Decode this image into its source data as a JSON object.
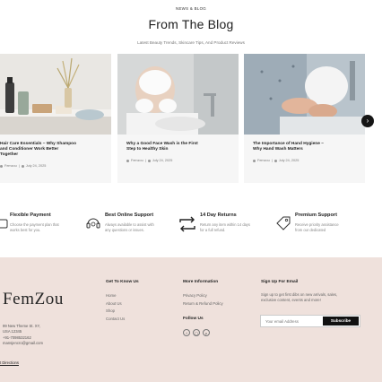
{
  "blog": {
    "eyebrow": "NEWS & BLOG",
    "title": "From The Blog",
    "subtitle": "Latest Beauty Trends, Skincare Tips, And Product Reviews",
    "next_icon": "chevron-right-icon",
    "posts": [
      {
        "title_line1": "Hair Care Essentials – Why Shampoo",
        "title_line2": "and Conditioner Work Better",
        "title_line3": "Together",
        "author": "Femzou",
        "date": "July 24, 2025"
      },
      {
        "title_line1": "Why a Good Face Wash is the First",
        "title_line2": "Step to Healthy Skin",
        "author": "Femzou",
        "date": "July 24, 2025"
      },
      {
        "title_line1": "The Importance of Hand Hygiene –",
        "title_line2": "Why Hand Wash Matters",
        "author": "Femzou",
        "date": "July 24, 2025"
      }
    ]
  },
  "features": [
    {
      "icon": "payment-icon",
      "title": "Flexible Payment",
      "desc_line1": "Choose the payment plan that",
      "desc_line2": "works best for you."
    },
    {
      "icon": "support-headset-icon",
      "title": "Best Online Support",
      "desc_line1": "Always available to assist with",
      "desc_line2": "any questions or issues."
    },
    {
      "icon": "return-arrows-icon",
      "title": "14 Day Returns",
      "desc_line1": "Return any item within 14 days",
      "desc_line2": "for a full refund."
    },
    {
      "icon": "tag-icon",
      "title": "Premium Support",
      "desc_line1": "Receive priority assistance",
      "desc_line2": "from our dedicated"
    }
  ],
  "footer": {
    "brand": "FemZou",
    "address_line1": "99 New Theme St. XY,",
    "address_line2": "USA 12345",
    "phone": "+91-7098532162",
    "email": "mansjencro@gmail.com",
    "directions": "t Directions",
    "col1_head": "Get To Know Us",
    "col1_items": [
      "Home",
      "About Us",
      "Shop",
      "Contact Us"
    ],
    "col2_head": "More Information",
    "col2_items": [
      "Privacy Policy",
      "Return & Refund Policy"
    ],
    "follow_head": "Follow Us",
    "social": [
      "facebook-icon",
      "instagram-icon",
      "pinterest-icon"
    ],
    "signup_head": "Sign Up For Email",
    "signup_line1": "Sign up to get first dibs on new arrivals, sales,",
    "signup_line2": "exclusive content, events and more!",
    "email_placeholder": "Your email Address",
    "subscribe_label": "Subscribe"
  }
}
